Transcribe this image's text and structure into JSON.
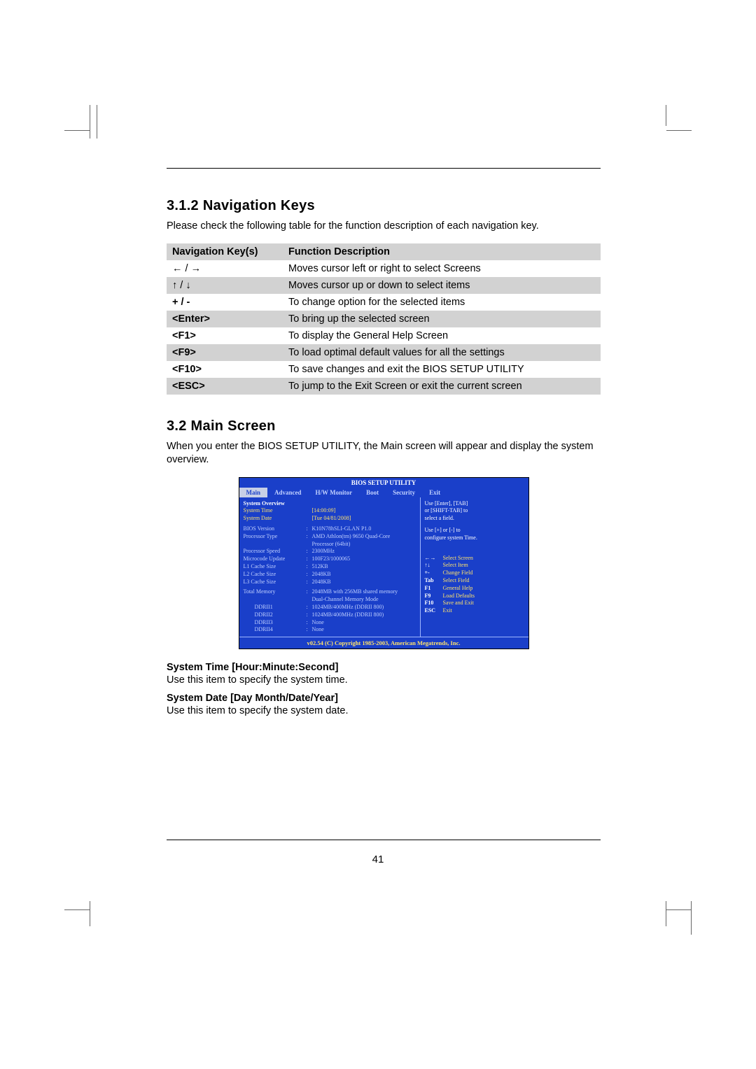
{
  "section1": {
    "heading": "3.1.2 Navigation Keys",
    "intro": "Please check the following table for the function description of each navigation key."
  },
  "table": {
    "h1": "Navigation Key(s)",
    "h2": "Function Description",
    "rows": [
      {
        "k": "← / →",
        "d": "Moves cursor left or right to select Screens"
      },
      {
        "k": "↑ / ↓",
        "d": "Moves cursor up or down to select items"
      },
      {
        "k": "+  /  -",
        "d": "To change option for the selected items"
      },
      {
        "k": "<Enter>",
        "d": "To bring up the selected screen"
      },
      {
        "k": "<F1>",
        "d": "To display the General Help Screen"
      },
      {
        "k": "<F9>",
        "d": "To load optimal default values for all the settings"
      },
      {
        "k": "<F10>",
        "d": "To save changes and exit the BIOS SETUP UTILITY"
      },
      {
        "k": "<ESC>",
        "d": "To jump to the Exit Screen or exit the current screen"
      }
    ]
  },
  "section2": {
    "heading": "3.2   Main Screen",
    "intro": "When you enter the BIOS SETUP UTILITY, the Main screen will appear and display the system overview."
  },
  "bios": {
    "title": "BIOS SETUP UTILITY",
    "tabs": [
      "Main",
      "Advanced",
      "H/W Monitor",
      "Boot",
      "Security",
      "Exit"
    ],
    "overview": "System Overview",
    "time_l": "System Time",
    "time_v": "[14:00:09]",
    "date_l": "System Date",
    "date_v": "[Tue 04/81/2008]",
    "rows": [
      {
        "l": "BIOS Version",
        "r": "K10N78hSLI-GLAN P1.0"
      },
      {
        "l": "Processor Type",
        "r": "AMD Athlon(tm) 9650 Quad-Core"
      },
      {
        "l": "",
        "r": "Processor (64bit)"
      },
      {
        "l": "Processor Speed",
        "r": "2300MHz"
      },
      {
        "l": "Microcode Update",
        "r": "100F23/1000065"
      },
      {
        "l": "L1 Cache Size",
        "r": "512KB"
      },
      {
        "l": "L2 Cache Size",
        "r": "2048KB"
      },
      {
        "l": "L3 Cache Size",
        "r": "2048KB"
      }
    ],
    "mem_l": "Total Memory",
    "mem_r": "2048MB with 256MB shared memory",
    "mem_r2": "Dual-Channel Memory Mode",
    "slots": [
      {
        "l": "DDRII1",
        "r": "1024MB/400MHz (DDRII 800)"
      },
      {
        "l": "DDRII2",
        "r": "1024MB/400MHz (DDRII 800)"
      },
      {
        "l": "DDRII3",
        "r": "None"
      },
      {
        "l": "DDRII4",
        "r": "None"
      }
    ],
    "help1a": "Use [Enter], [TAB]",
    "help1b": "or [SHIFT-TAB] to",
    "help1c": "select a field.",
    "help2a": "Use [+] or [-] to",
    "help2b": "configure system Time.",
    "keys": [
      {
        "k": "←→",
        "d": "Select Screen"
      },
      {
        "k": "↑↓",
        "d": "Select Item"
      },
      {
        "k": "+-",
        "d": "Change Field"
      },
      {
        "k": "Tab",
        "d": "Select Field"
      },
      {
        "k": "F1",
        "d": "General Help"
      },
      {
        "k": "F9",
        "d": "Load Defaults"
      },
      {
        "k": "F10",
        "d": "Save and Exit"
      },
      {
        "k": "ESC",
        "d": "Exit"
      }
    ],
    "footer": "v02.54 (C) Copyright 1985-2003, American Megatrends, Inc."
  },
  "items": {
    "t1": "System Time [Hour:Minute:Second]",
    "d1": "Use this item to specify the system time.",
    "t2": "System Date [Day Month/Date/Year]",
    "d2": "Use this item to specify the system date."
  },
  "pagenum": "41"
}
